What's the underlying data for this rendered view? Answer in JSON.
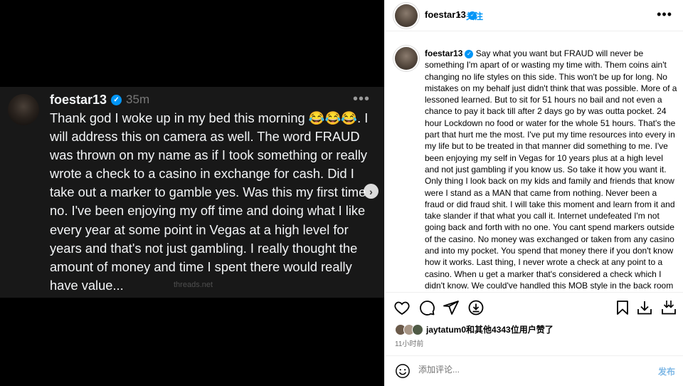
{
  "thread": {
    "username": "foestar13",
    "time": "35m",
    "more": "•••",
    "text": "Thank god I woke up in my bed this morning 😂😂😂. I will address this on camera as well. The word FRAUD  was thrown on my name as if I took something or really wrote a check to a casino in exchange for cash. Did I take out a marker to gamble yes. Was this my first time no. I've been enjoying my off time and doing what I like every year at some point in Vegas at a high level for years and that's not just gambling. I really thought the amount of money and time I spent there would really have value...",
    "watermark": "threads.net"
  },
  "post": {
    "header_username": "foestar13",
    "dot": "•",
    "follow_label": "关注",
    "more": "•••",
    "caption_username": "foestar13",
    "caption_text": "Say what you want but FRAUD will never be something I'm apart of or wasting my time with. Them coins ain't changing no life styles on this side. This won't be up for long. No mistakes on my behalf just didn't think that was possible. More of a lessoned learned. But to sit for 51 hours no bail and not even a chance to pay it back till after 2 days go by was outta pocket. 24 hour Lockdown no food or water for the whole 51 hours. That's the part that hurt me the most. I've put my time resources into every in my life but to be treated in that manner did something to me. I've been enjoying my self in Vegas for 10 years plus at a high level and not just gambling if you know us. So take it how you want it. Only thing I look back on my kids and family and friends that know were I stand as a MAN that came from nothing. Never been a fraud or did fraud shit. I will take this moment and learn from it and take slander if that what you call it. Internet undefeated I'm not going back and forth with no one. You cant spend markers outside of the casino. No money was exchanged or taken from any casino and into my pocket. You spend that money there if you don't know how it works. Last thing, I never wrote a check at any point to a casino. When u get a marker that's considered a check which I didn't know. We could've handled this MOB style in the back room at the casinos",
    "likes_text": "jaytatum0和其他4343位用户赞了",
    "time_ago": "11小时前",
    "comment_placeholder": "添加评论...",
    "post_label": "发布"
  },
  "colors": {
    "accent": "#0095f6",
    "dark_card": "#181818"
  },
  "icons": [
    "heart-icon",
    "comment-icon",
    "share-icon",
    "remix-icon",
    "bookmark-icon",
    "download-icon",
    "download-all-icon",
    "emoji-icon",
    "chevron-right-icon",
    "verified-icon"
  ]
}
